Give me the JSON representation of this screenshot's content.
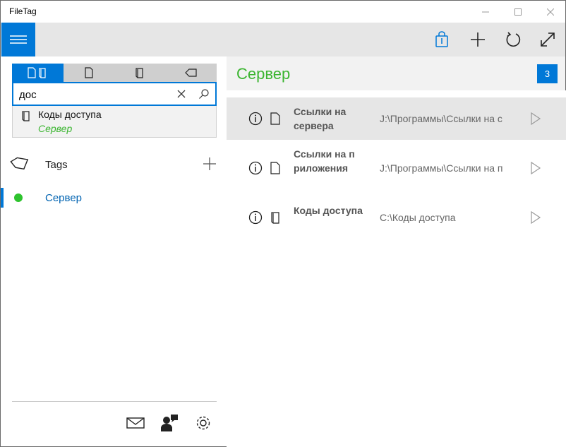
{
  "window": {
    "title": "FileTag"
  },
  "appbar": {
    "menu_icon": "hamburger-icon",
    "actions": [
      "bag-icon",
      "add-icon",
      "refresh-icon",
      "fullscreen-icon"
    ]
  },
  "search": {
    "value": "дос",
    "placeholder": ""
  },
  "segments": [
    "all-icon",
    "file-icon",
    "folder-icon",
    "tag-icon"
  ],
  "suggestion": {
    "name": "Коды доступа",
    "tag": "Сервер"
  },
  "tags_section": {
    "label": "Tags"
  },
  "tags": [
    {
      "name": "Сервер",
      "color": "#2ec32e"
    }
  ],
  "right": {
    "title": "Сервер",
    "count": "3",
    "files": [
      {
        "name": "Ссылки на сервера",
        "path": "J:\\Программы\\Ссылки на с",
        "kind": "file"
      },
      {
        "name": "Ссылки на приложения",
        "path": "J:\\Программы\\Ссылки на п",
        "kind": "file"
      },
      {
        "name": "Коды доступа",
        "path": "C:\\Коды доступа",
        "kind": "folder"
      }
    ]
  },
  "colors": {
    "accent": "#0078d7",
    "tag_green": "#3cb531"
  }
}
